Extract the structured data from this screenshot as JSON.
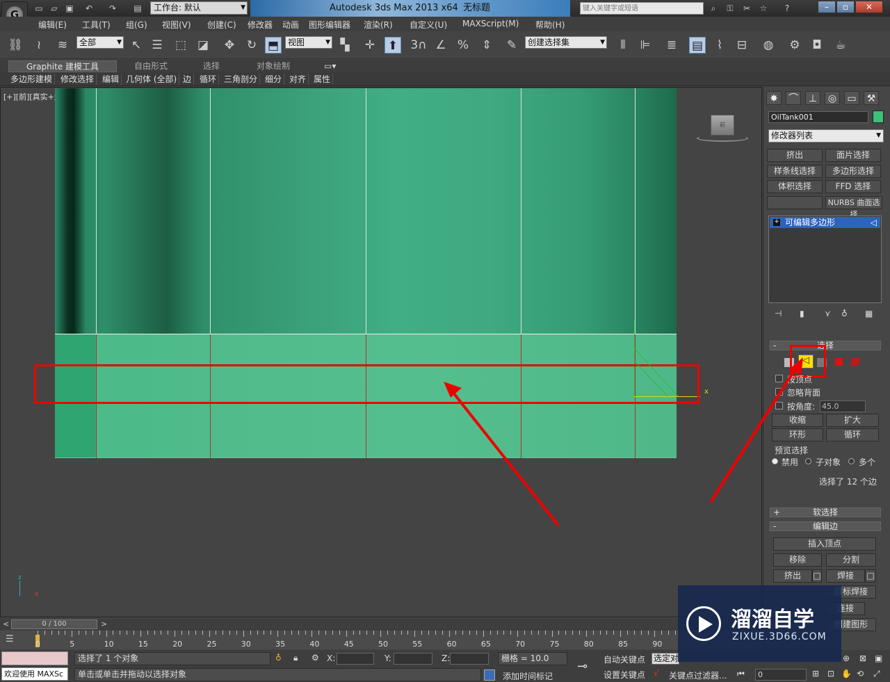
{
  "titlebar": {
    "logo": "G",
    "workspace": "工作台: 默认",
    "app_title": "Autodesk 3ds Max  2013 x64",
    "doc_title": "无标题",
    "search_placeholder": "键入关键字或短语"
  },
  "menu": [
    "编辑(E)",
    "工具(T)",
    "组(G)",
    "视图(V)",
    "创建(C)",
    "修改器",
    "动画",
    "图形编辑器",
    "渲染(R)",
    "自定义(U)",
    "MAXScript(M)",
    "帮助(H)"
  ],
  "toolbar": {
    "filter": "全部",
    "ref_coord": "视图",
    "named_sel": "创建选择集",
    "snap_labels": [
      "3",
      "%"
    ]
  },
  "ribbon": {
    "tabs": [
      "Graphite 建模工具",
      "自由形式",
      "选择",
      "对象绘制"
    ],
    "items": [
      "多边形建模",
      "修改选择",
      "编辑",
      "几何体 (全部)",
      "边",
      "循环",
      "三角剖分",
      "细分",
      "对齐",
      "属性"
    ]
  },
  "viewport": {
    "label": "[+][前][真实+边面]",
    "axis_x": "x",
    "axis_z": "z",
    "viewcube": "前"
  },
  "panel": {
    "object_name": "OilTank001",
    "object_color": "#3ec07a",
    "modifier_list": "修改器列表",
    "buttons": [
      "挤出",
      "面片选择",
      "样条线选择",
      "多边形选择",
      "体积选择",
      "FFD 选择",
      "",
      "NURBS 曲面选择"
    ],
    "stack_item": "可编辑多边形",
    "selection_title": "选择",
    "by_vertex": "按顶点",
    "ignore_back": "忽略背面",
    "by_angle": "按角度:",
    "angle_value": "45.0",
    "shrink": "收缩",
    "grow": "扩大",
    "ring": "环形",
    "loop": "循环",
    "preview_title": "预览选择",
    "preview_opts": [
      "禁用",
      "子对象",
      "多个"
    ],
    "selected_info": "选择了 12 个边",
    "soft_sel": "软选择",
    "edit_edges": "编辑边",
    "insert_vertex": "插入顶点",
    "remove": "移除",
    "split": "分割",
    "extrude": "挤出",
    "weld": "焊接",
    "target_weld": "目标焊接",
    "bridge": "连接",
    "create_shape": "创建图形"
  },
  "timeline": {
    "frame": "0 / 100",
    "ticks": [
      "0",
      "5",
      "10",
      "15",
      "20",
      "25",
      "30",
      "35",
      "40",
      "45",
      "50",
      "55",
      "60",
      "65",
      "70",
      "75",
      "80",
      "85",
      "90"
    ]
  },
  "status": {
    "welcome": "欢迎使用 MAXSc",
    "selected": "选择了 1 个对象",
    "prompt": "单击或单击并拖动以选择对象",
    "x_label": "X:",
    "y_label": "Y:",
    "z_label": "Z:",
    "grid": "栅格 = 10.0",
    "auto_key": "自动关键点",
    "set_key": "设置关键点",
    "sel_dd": "选定对",
    "add_time_tag": "添加时间标记",
    "key_filter": "关键点过滤器...",
    "frame_field": "0"
  },
  "watermark": {
    "brand": "溜溜自学",
    "url": "ZIXUE.3D66.COM"
  }
}
